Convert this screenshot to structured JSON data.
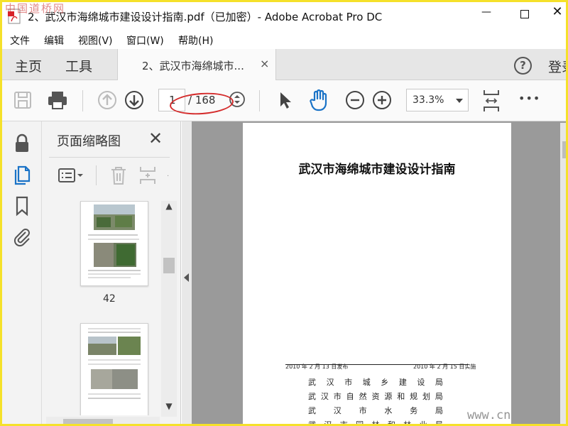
{
  "watermark_top": "中国道桥网",
  "watermark_bottom": "www.cn",
  "window": {
    "title": "2、武汉市海绵城市建设设计指南.pdf（已加密）- Adobe Acrobat Pro DC"
  },
  "menu": [
    "文件",
    "编辑",
    "视图(V)",
    "窗口(W)",
    "帮助(H)"
  ],
  "tabs": {
    "home": "主页",
    "tools": "工具",
    "document": "2、武汉市海绵城市...",
    "close": "×",
    "help": "?",
    "login": "登录"
  },
  "toolbar": {
    "current_page": "1",
    "total_pages": "/ 168",
    "zoom": "33.3%",
    "more": "•••"
  },
  "thumbnail_panel": {
    "title": "页面缩略图",
    "page_labels": [
      "42"
    ]
  },
  "document": {
    "title": "武汉市海绵城市建设设计指南",
    "issue_date": "2010 年 2 月 13 日发布",
    "effective_date": "2010 年 2 月 15 日实施",
    "organizations": [
      [
        "武",
        "汉",
        "市",
        "城",
        "乡",
        "建",
        "设",
        "局"
      ],
      [
        "武",
        "汉",
        "市",
        "自",
        "然",
        "资",
        "源",
        "和",
        "规",
        "划",
        "局"
      ],
      [
        "武",
        "汉",
        "市",
        "水",
        "务",
        "局"
      ],
      [
        "武",
        "汉",
        "市",
        "园",
        "林",
        "和",
        "林",
        "业",
        "局"
      ]
    ]
  },
  "colors": {
    "accent_blue": "#1a73c7",
    "annotation_red": "#d42b2b",
    "frame_yellow": "#f5e12a"
  }
}
